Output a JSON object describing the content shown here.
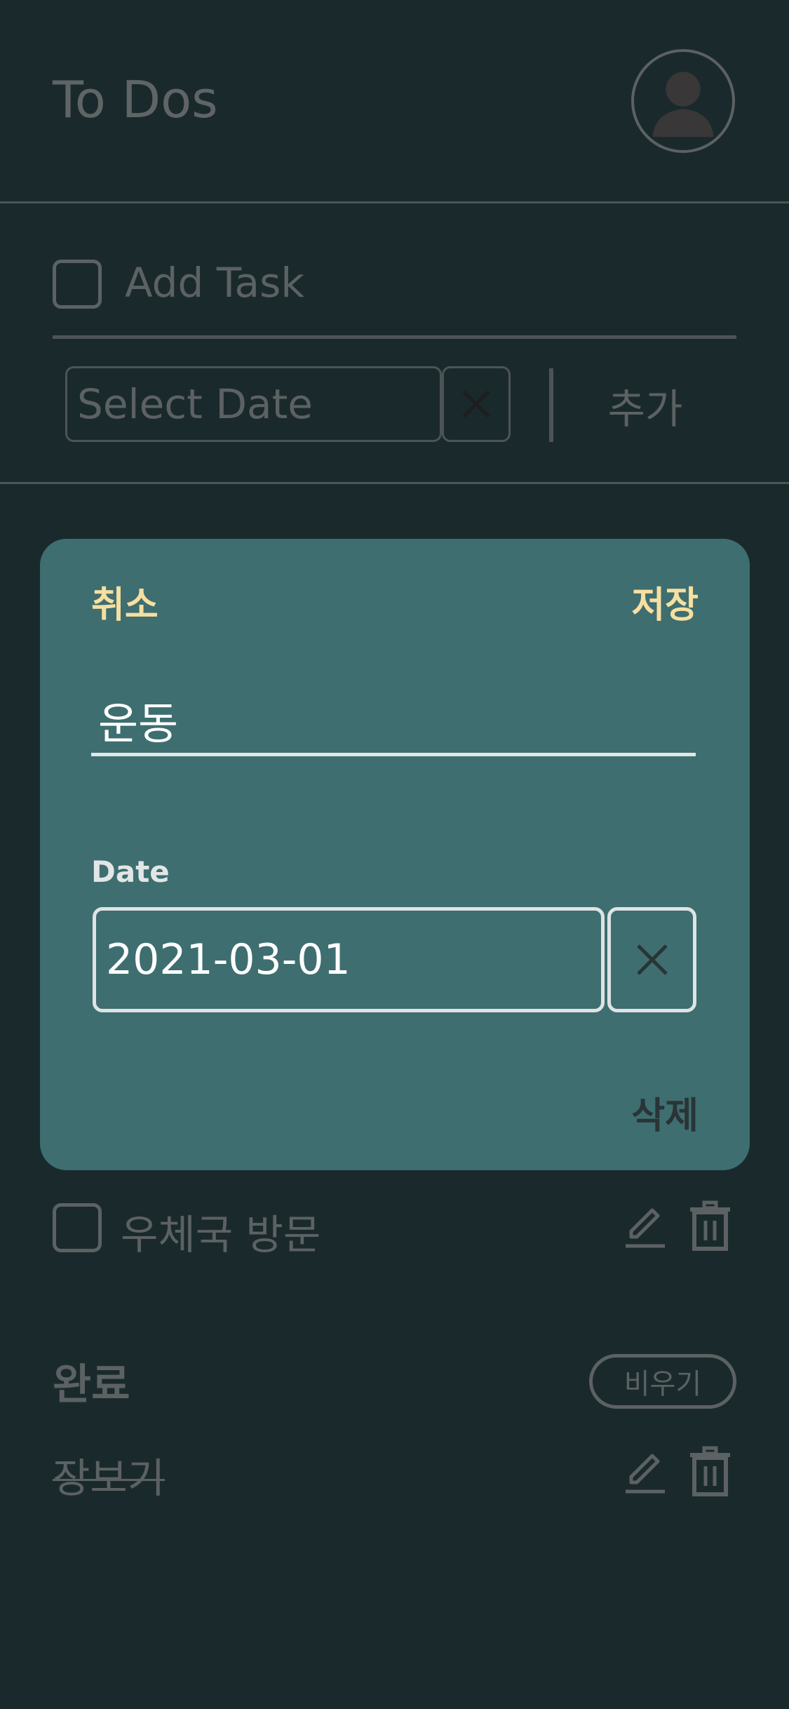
{
  "header": {
    "title": "To Dos"
  },
  "add_task": {
    "placeholder": "Add Task",
    "date_placeholder": "Select Date",
    "add_label": "추가"
  },
  "todos": [
    {
      "label": "우체국 방문",
      "completed": false
    }
  ],
  "done_section": {
    "title": "완료",
    "clear_label": "비우기",
    "items": [
      {
        "label": "장보기",
        "completed": true
      }
    ]
  },
  "edit_modal": {
    "cancel_label": "취소",
    "save_label": "저장",
    "task_name": "운동",
    "date_label": "Date",
    "date_value": "2021-03-01",
    "delete_label": "삭제"
  },
  "colors": {
    "background": "#1a2a2c",
    "modal": "#3e6e70",
    "accent": "#f7dfa0",
    "muted": "#5c6163"
  }
}
